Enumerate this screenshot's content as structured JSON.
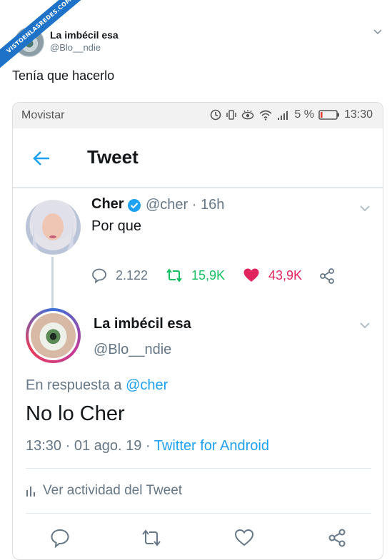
{
  "watermark": {
    "text": "VISTOENLASREDES.COM"
  },
  "outer_tweet": {
    "name": "La imbécil esa",
    "handle": "@Blo__ndie",
    "text": "Tenía que hacerlo"
  },
  "phone": {
    "statusbar": {
      "carrier": "Movistar",
      "battery": "5 %",
      "time": "13:30"
    },
    "appbar": {
      "title": "Tweet"
    },
    "parent_tweet": {
      "name": "Cher",
      "handle_time": "@cher · 16h",
      "text": "Por que",
      "replies": "2.122",
      "retweets": "15,9K",
      "likes": "43,9K"
    },
    "main_tweet": {
      "name": "La imbécil esa",
      "handle": "@Blo__ndie",
      "reply_prefix": "En respuesta a",
      "reply_to": "@cher",
      "text": "No lo Cher",
      "timestamp": "13:30 · 01 ago. 19 ·",
      "client": "Twitter for Android",
      "activity_label": "Ver actividad del Tweet"
    }
  },
  "colors": {
    "twitter_blue": "#1da1f2",
    "retweet_green": "#17bf63",
    "like_red": "#e0245e",
    "secondary_text": "#657786"
  }
}
